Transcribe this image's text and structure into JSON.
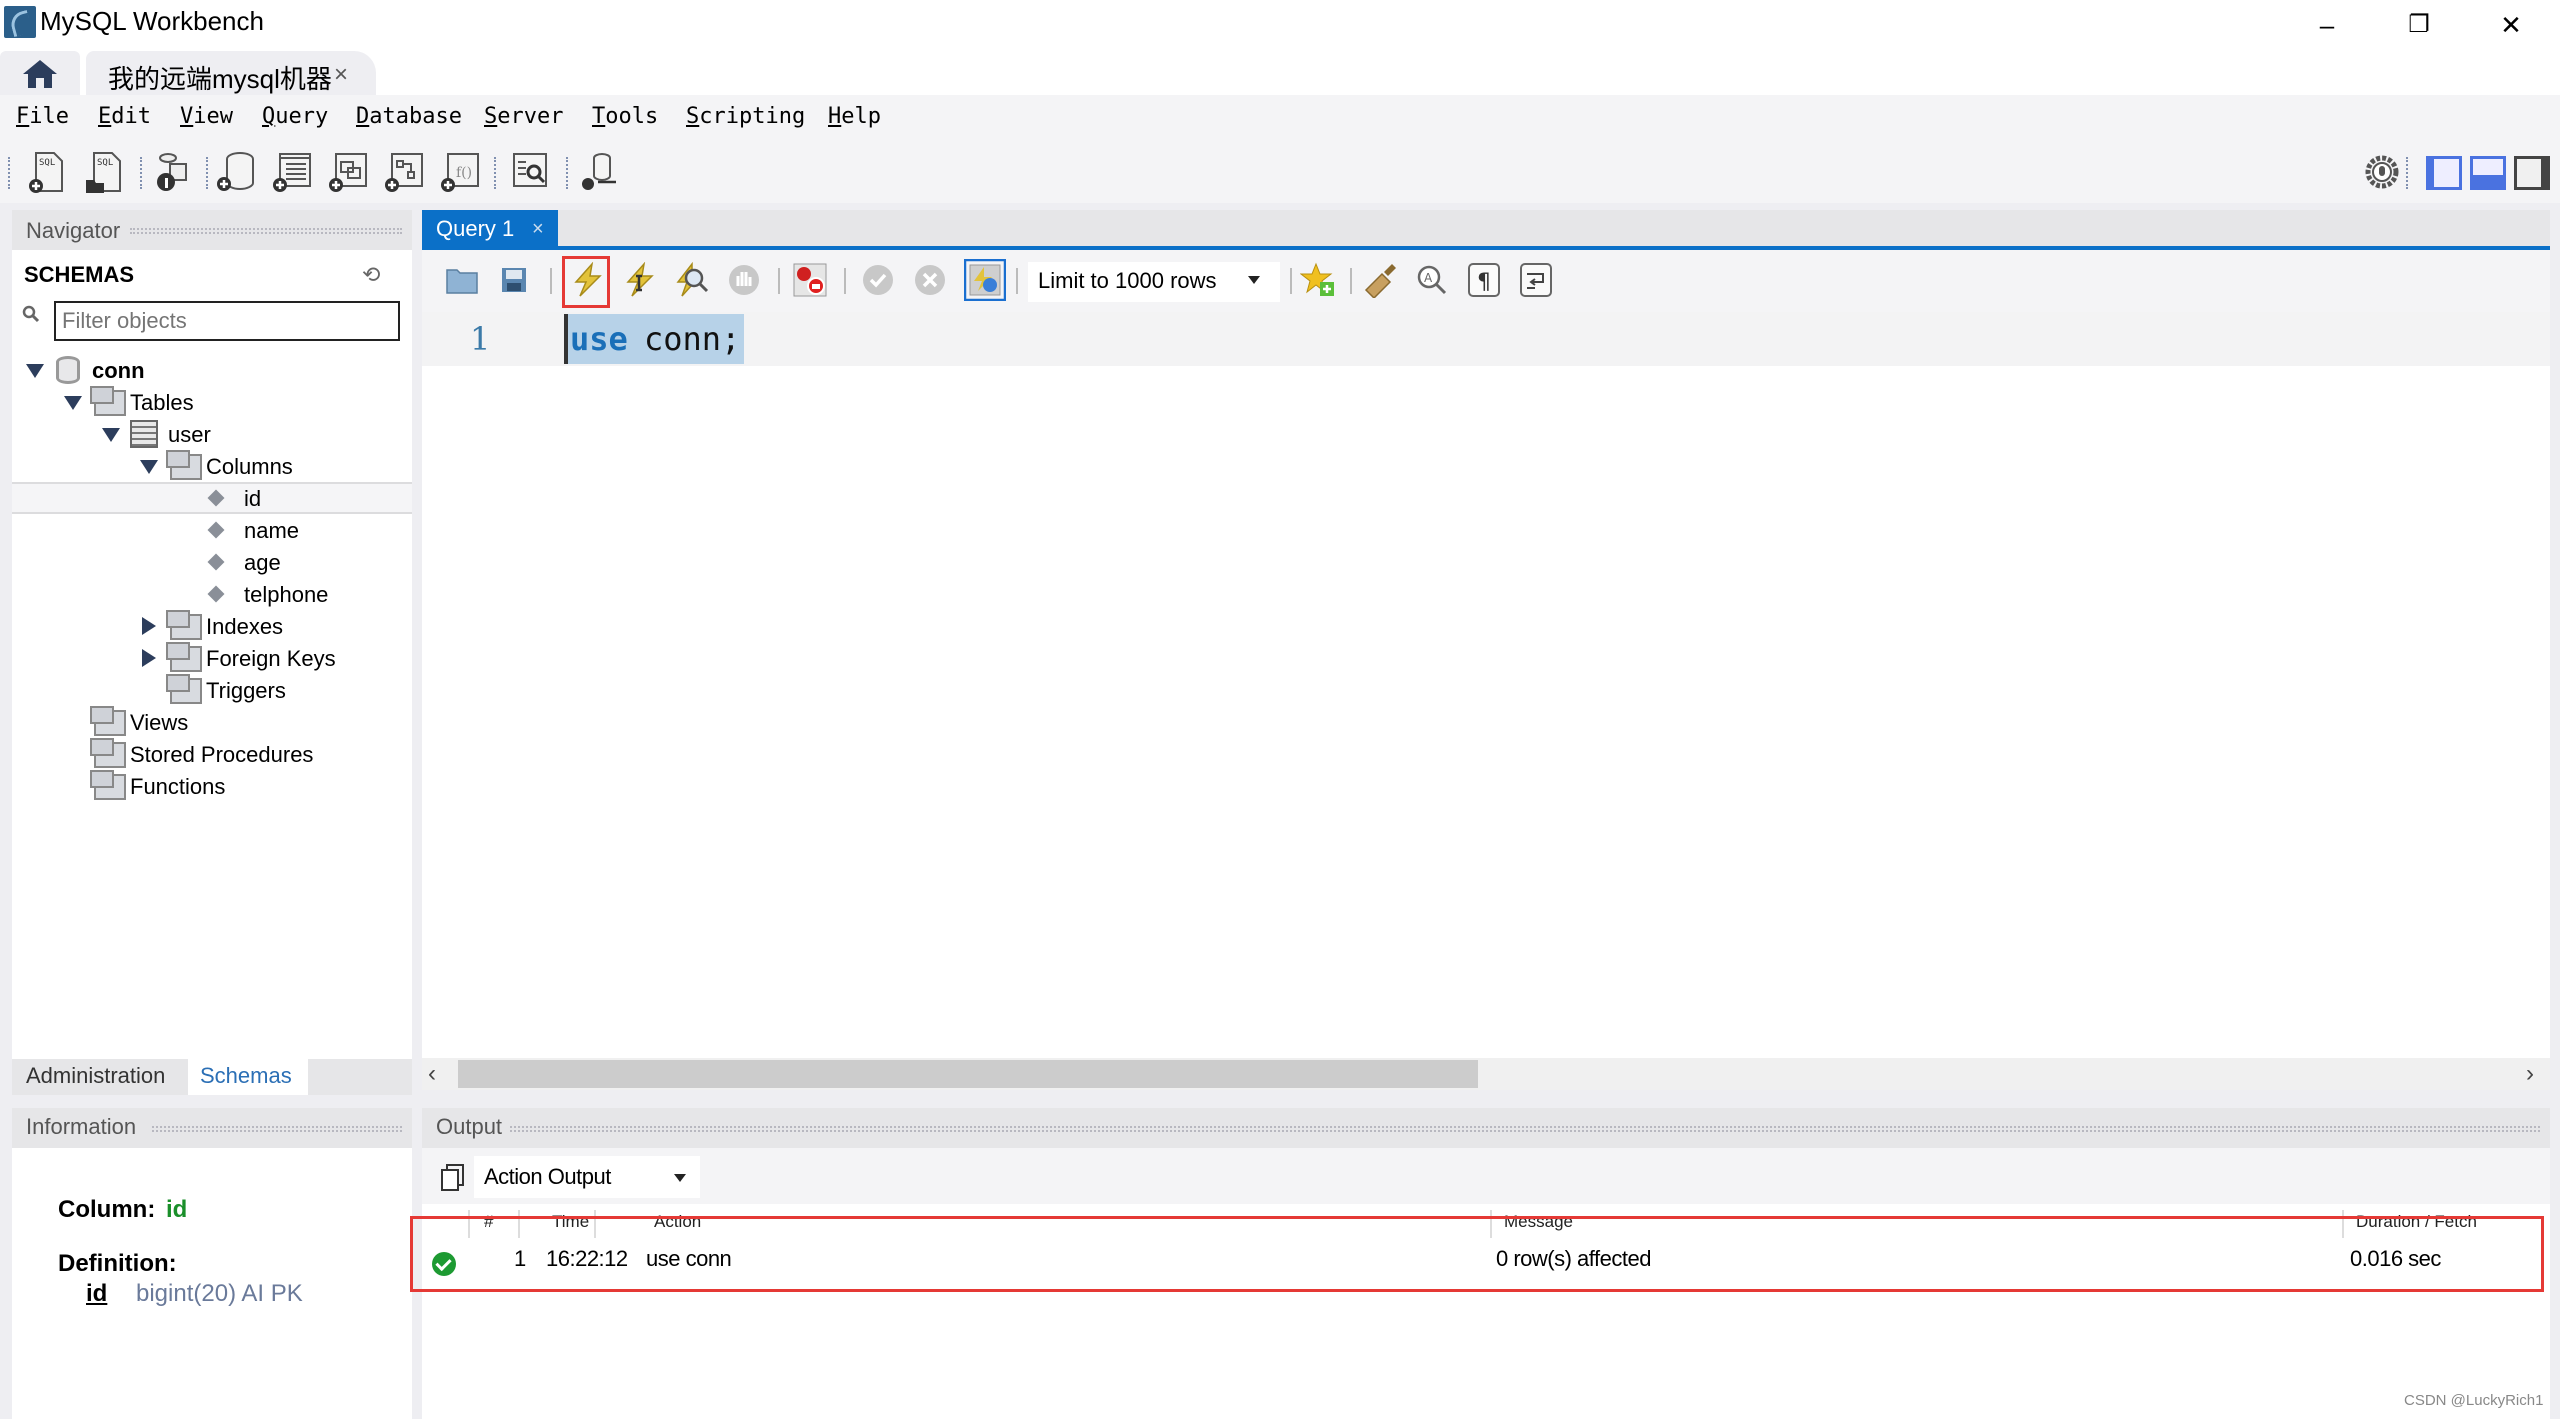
{
  "window": {
    "title": "MySQL Workbench",
    "controls": {
      "minimize": "–",
      "restore": "❐",
      "close": "✕"
    }
  },
  "tabs": {
    "home_icon": "home-icon",
    "connection_tab": {
      "label": "我的远端mysql机器",
      "close": "×"
    }
  },
  "menu": [
    {
      "label": "File",
      "key": "F"
    },
    {
      "label": "Edit",
      "key": "E"
    },
    {
      "label": "View",
      "key": "V"
    },
    {
      "label": "Query",
      "key": "Q"
    },
    {
      "label": "Database",
      "key": "D"
    },
    {
      "label": "Server",
      "key": "S"
    },
    {
      "label": "Tools",
      "key": "T"
    },
    {
      "label": "Scripting",
      "key": "S"
    },
    {
      "label": "Help",
      "key": "H"
    }
  ],
  "toolbar": {
    "icons": [
      "new-sql-tab-icon",
      "open-sql-script-icon",
      "schema-inspector-icon",
      "create-schema-icon",
      "create-table-icon",
      "create-view-icon",
      "create-procedure-icon",
      "create-function-icon",
      "search-table-data-icon",
      "reconnect-icon"
    ],
    "right_icons": [
      "settings-icon",
      "toggle-sidebar-icon",
      "toggle-output-icon",
      "toggle-secondary-sidebar-icon"
    ]
  },
  "navigator": {
    "header": "Navigator",
    "section": "SCHEMAS",
    "filter_placeholder": "Filter objects",
    "tree": [
      {
        "label": "conn",
        "level": 0,
        "expanded": true,
        "icon": "database-icon",
        "bold": true
      },
      {
        "label": "Tables",
        "level": 1,
        "expanded": true,
        "icon": "tables-folder-icon"
      },
      {
        "label": "user",
        "level": 2,
        "expanded": true,
        "icon": "table-icon"
      },
      {
        "label": "Columns",
        "level": 3,
        "expanded": true,
        "icon": "columns-folder-icon"
      },
      {
        "label": "id",
        "level": 4,
        "icon": "column-icon",
        "selected": true
      },
      {
        "label": "name",
        "level": 4,
        "icon": "column-icon"
      },
      {
        "label": "age",
        "level": 4,
        "icon": "column-icon"
      },
      {
        "label": "telphone",
        "level": 4,
        "icon": "column-icon"
      },
      {
        "label": "Indexes",
        "level": 3,
        "expanded": false,
        "icon": "indexes-folder-icon"
      },
      {
        "label": "Foreign Keys",
        "level": 3,
        "expanded": false,
        "icon": "foreign-keys-folder-icon"
      },
      {
        "label": "Triggers",
        "level": 3,
        "icon": "triggers-folder-icon"
      },
      {
        "label": "Views",
        "level": 1,
        "icon": "views-folder-icon"
      },
      {
        "label": "Stored Procedures",
        "level": 1,
        "icon": "procedures-folder-icon"
      },
      {
        "label": "Functions",
        "level": 1,
        "icon": "functions-folder-icon"
      }
    ],
    "tabs": {
      "administration": "Administration",
      "schemas": "Schemas"
    }
  },
  "information": {
    "header": "Information",
    "column_label": "Column:",
    "column_name": "id",
    "definition_label": "Definition:",
    "def_name": "id",
    "def_type": "bigint(20) AI PK"
  },
  "query": {
    "tab_label": "Query 1",
    "tab_close": "×",
    "limit_option": "Limit to 1000 rows",
    "line_number": "1",
    "code_keyword": "use",
    "code_rest": "conn;"
  },
  "output": {
    "header": "Output",
    "select_value": "Action Output",
    "columns": [
      "#",
      "Time",
      "Action",
      "Message",
      "Duration / Fetch"
    ],
    "rows": [
      {
        "status": "success",
        "num": "1",
        "time": "16:22:12",
        "action": "use conn",
        "message": "0 row(s) affected",
        "duration": "0.016 sec"
      }
    ]
  },
  "watermark": "CSDN @LuckyRich1",
  "colors": {
    "accent": "#0b70c8",
    "highlight": "#e53935",
    "success": "#1d9a32"
  }
}
